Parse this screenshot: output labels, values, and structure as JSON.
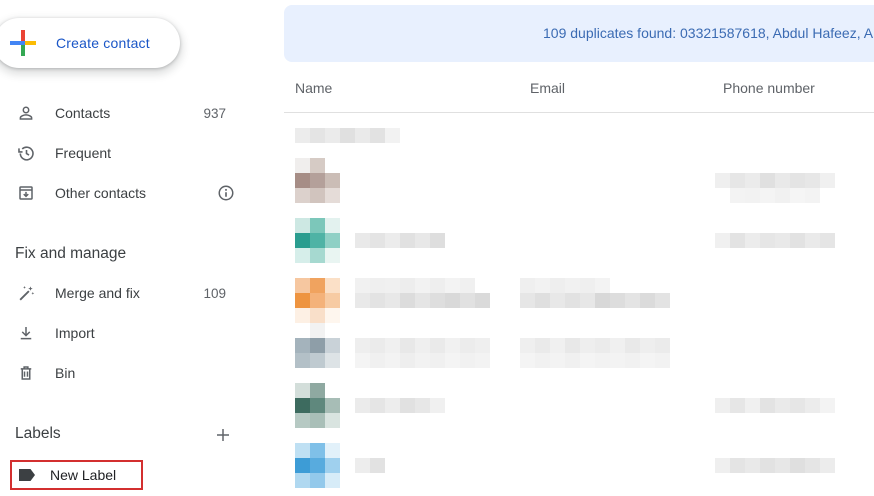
{
  "sidebar": {
    "create_contact": "Create contact",
    "items": [
      {
        "label": "Contacts",
        "count": "937",
        "icon": "person-icon"
      },
      {
        "label": "Frequent",
        "count": "",
        "icon": "history-icon"
      },
      {
        "label": "Other contacts",
        "count": "",
        "icon": "archive-icon"
      }
    ],
    "fix_manage_title": "Fix and manage",
    "fix_items": [
      {
        "label": "Merge and fix",
        "count": "109",
        "icon": "auto-fix-icon"
      },
      {
        "label": "Import",
        "count": "",
        "icon": "download-icon"
      },
      {
        "label": "Bin",
        "count": "",
        "icon": "trash-icon"
      }
    ],
    "labels_title": "Labels",
    "new_label": "New Label"
  },
  "banner": {
    "text": "109 duplicates found: 03321587618, Abdul Hafeez, A"
  },
  "table": {
    "columns": [
      "Name",
      "Email",
      "Phone number"
    ]
  },
  "colors": {
    "accent": "#1a56c7",
    "banner_bg": "#e8f0fe",
    "highlight_border": "#d32f2f"
  }
}
